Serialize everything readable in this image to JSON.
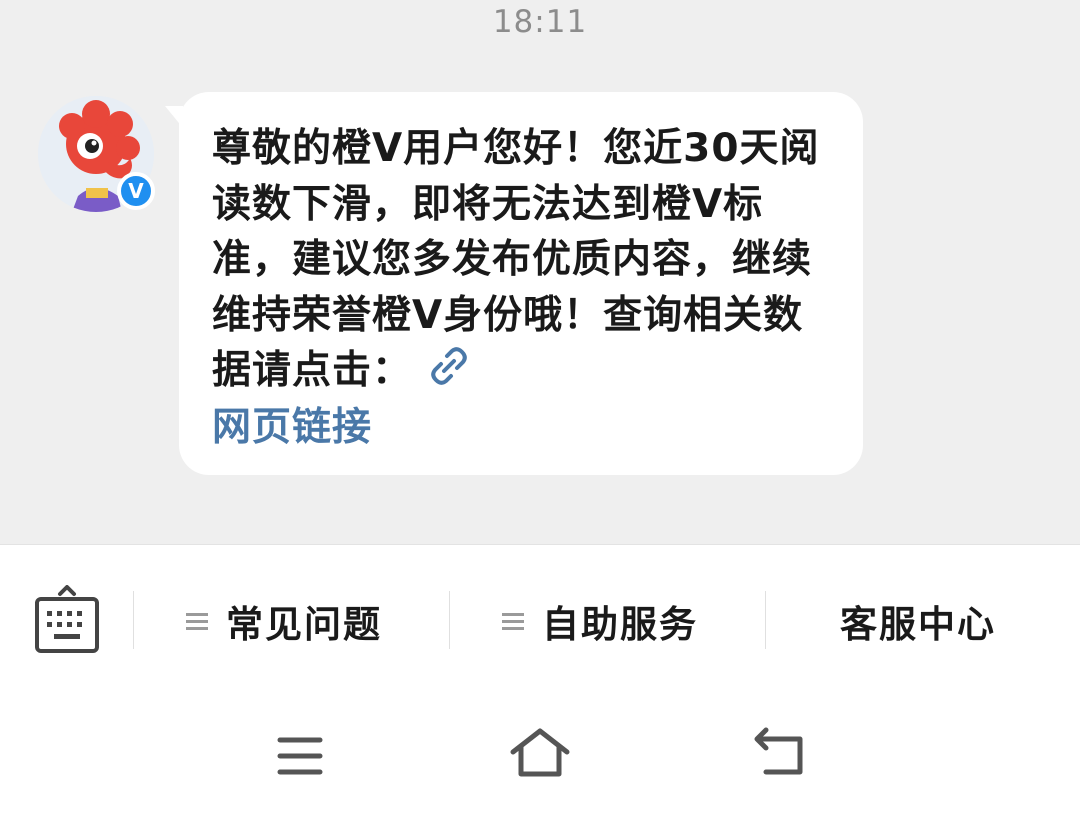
{
  "status": {
    "time": "18:11"
  },
  "message": {
    "text": "尊敬的橙V用户您好！您近30天阅读数下滑，即将无法达到橙V标准，建议您多发布优质内容，继续维持荣誉橙V身份哦！查询相关数据请点击：",
    "link_text": "网页链接"
  },
  "avatar": {
    "verified_badge": "V"
  },
  "menu": {
    "items": [
      "常见问题",
      "自助服务",
      "客服中心"
    ]
  },
  "colors": {
    "chat_background": "#efefef",
    "bubble": "#ffffff",
    "link": "#4a78a8",
    "verified_badge": "#1f8ff0",
    "mascot": "#e8473a"
  },
  "icons": {
    "keyboard": "keyboard-icon",
    "link": "link-icon",
    "nav_menu": "menu-icon",
    "nav_home": "home-icon",
    "nav_back": "back-icon"
  }
}
